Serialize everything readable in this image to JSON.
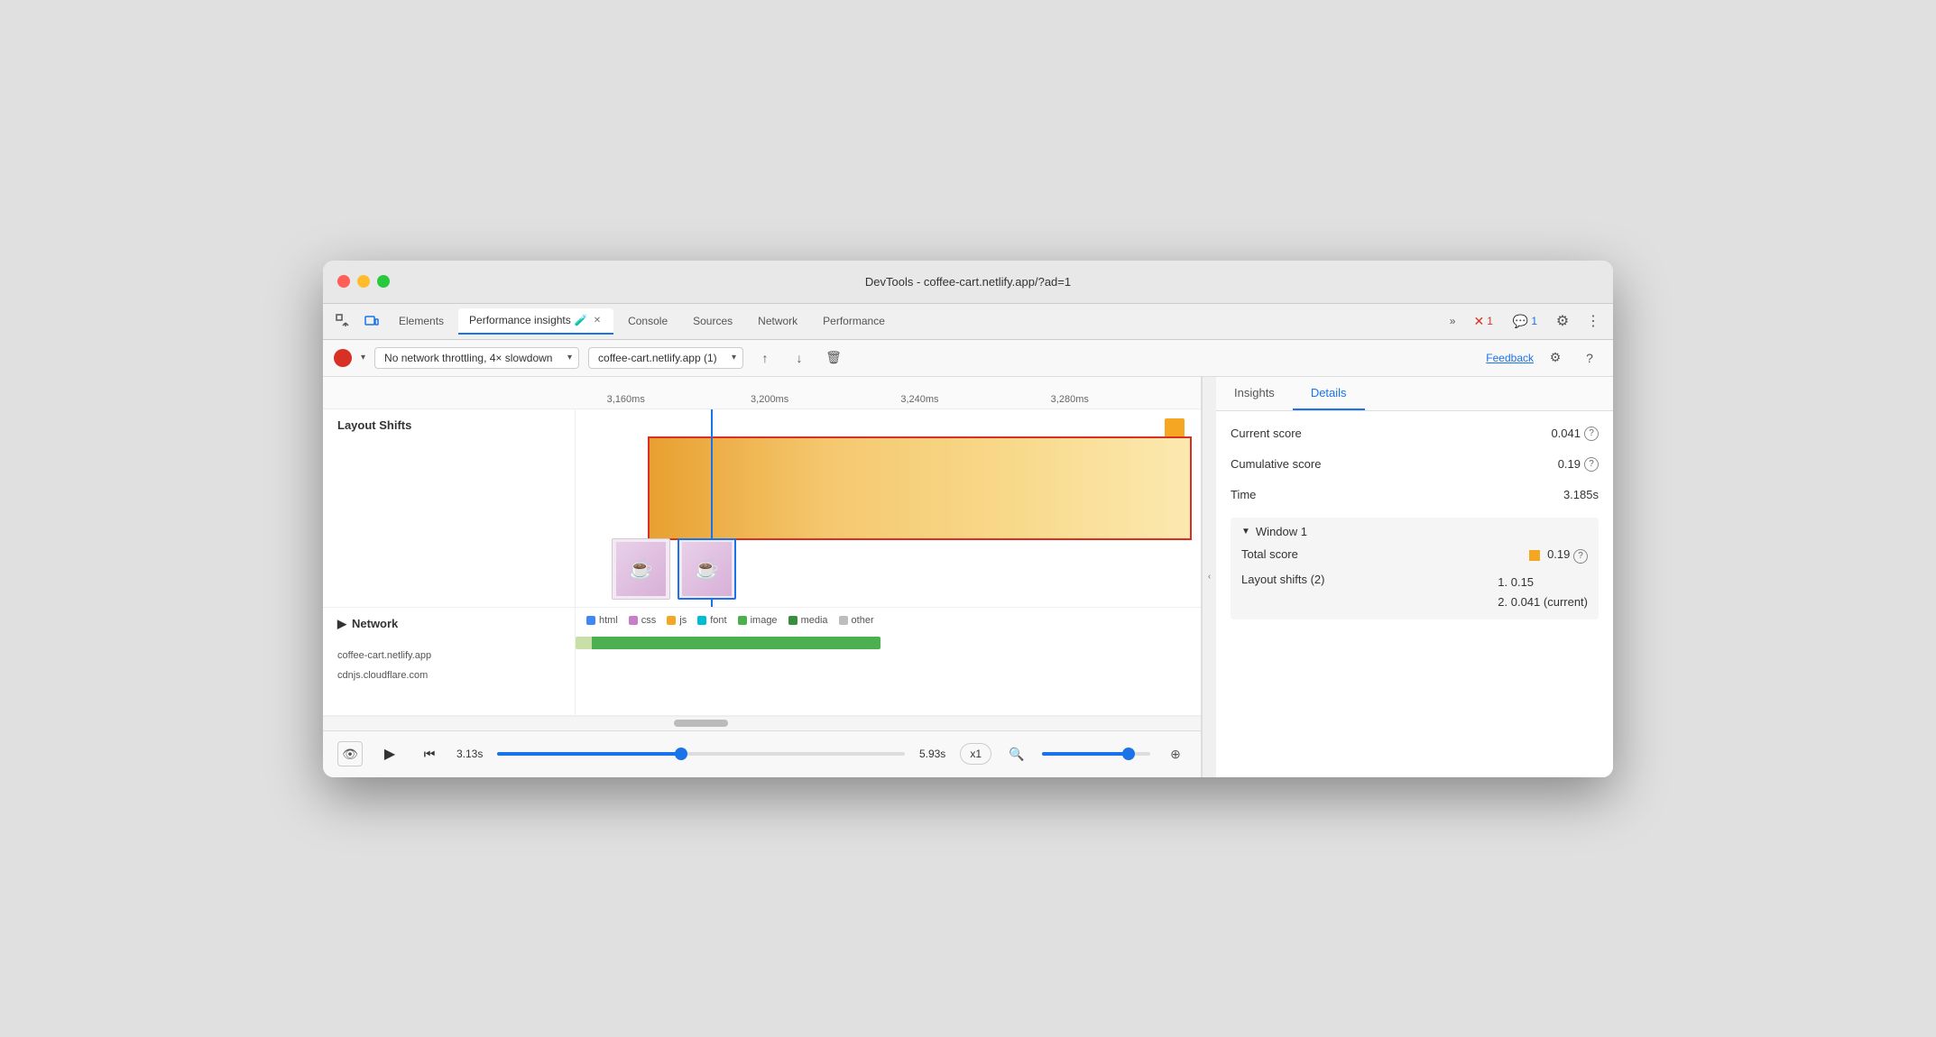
{
  "window": {
    "title": "DevTools - coffee-cart.netlify.app/?ad=1"
  },
  "tabs": {
    "items": [
      {
        "label": "Elements",
        "active": false
      },
      {
        "label": "Performance insights",
        "active": true
      },
      {
        "label": "Console",
        "active": false
      },
      {
        "label": "Sources",
        "active": false
      },
      {
        "label": "Network",
        "active": false
      },
      {
        "label": "Performance",
        "active": false
      }
    ],
    "more_label": "»",
    "error_badge": "1",
    "info_badge": "1"
  },
  "toolbar": {
    "throttle_option": "No network throttling, 4× slowdown",
    "url_option": "coffee-cart.netlify.app (1)",
    "feedback_label": "Feedback"
  },
  "timeline": {
    "ticks": [
      "3,160ms",
      "3,200ms",
      "3,240ms",
      "3,280ms"
    ]
  },
  "layout_shifts": {
    "label": "Layout Shifts"
  },
  "network": {
    "label": "Network",
    "rows": [
      "coffee-cart.netlify.app",
      "cdnjs.cloudflare.com"
    ],
    "legend": [
      {
        "label": "html",
        "color": "#4285f4"
      },
      {
        "label": "css",
        "color": "#c77dca"
      },
      {
        "label": "js",
        "color": "#f5a623"
      },
      {
        "label": "font",
        "color": "#00bcd4"
      },
      {
        "label": "image",
        "color": "#4caf50"
      },
      {
        "label": "media",
        "color": "#388e3c"
      },
      {
        "label": "other",
        "color": "#bdbdbd"
      }
    ]
  },
  "bottom_bar": {
    "time_start": "3.13s",
    "time_end": "5.93s",
    "speed_label": "x1"
  },
  "right_panel": {
    "tabs": [
      {
        "label": "Insights"
      },
      {
        "label": "Details"
      }
    ],
    "active_tab": "Details",
    "current_score_label": "Current score",
    "current_score_value": "0.041",
    "cumulative_score_label": "Cumulative score",
    "cumulative_score_value": "0.19",
    "time_label": "Time",
    "time_value": "3.185s",
    "window_label": "Window 1",
    "total_score_label": "Total score",
    "total_score_value": "0.19",
    "layout_shifts_label": "Layout shifts (2)",
    "layout_shift_1": "1. 0.15",
    "layout_shift_2": "2. 0.041 (current)"
  }
}
